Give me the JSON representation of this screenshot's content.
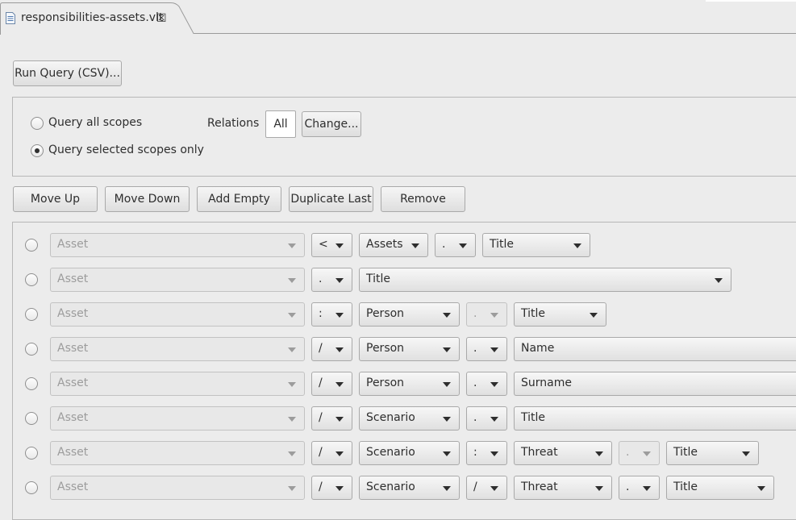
{
  "editor_tab": {
    "title": "responsibilities-assets.vlt",
    "close_glyph": "☒",
    "icon": "file-document-icon"
  },
  "toolbar": {
    "run_query_label": "Run Query (CSV)..."
  },
  "scope": {
    "query_all_label": "Query all scopes",
    "query_selected_label": "Query selected scopes only",
    "selected": "query_selected",
    "relations_label": "Relations",
    "relations_value": "All",
    "change_label": "Change..."
  },
  "row_actions": {
    "move_up": "Move Up",
    "move_down": "Move Down",
    "add_empty": "Add Empty",
    "duplicate_last": "Duplicate Last",
    "remove": "Remove"
  },
  "rows": [
    {
      "source": "Asset",
      "op1": "<",
      "target": "Assets",
      "op2": ".",
      "attribute": "Title"
    },
    {
      "source": "Asset",
      "op1": ".",
      "attribute": "Title"
    },
    {
      "source": "Asset",
      "op1": ":",
      "target": "Person",
      "op2": ".",
      "attribute": "Title"
    },
    {
      "source": "Asset",
      "op1": "/",
      "target": "Person",
      "op2": ".",
      "attribute": "Name"
    },
    {
      "source": "Asset",
      "op1": "/",
      "target": "Person",
      "op2": ".",
      "attribute": "Surname"
    },
    {
      "source": "Asset",
      "op1": "/",
      "target": "Scenario",
      "op2": ".",
      "attribute": "Title"
    },
    {
      "source": "Asset",
      "op1": "/",
      "target": "Scenario",
      "op2": ":",
      "target2": "Threat",
      "op3": ".",
      "attribute": "Title"
    },
    {
      "source": "Asset",
      "op1": "/",
      "target": "Scenario",
      "op2": "/",
      "target2": "Threat",
      "op3": ".",
      "attribute": "Title"
    }
  ]
}
